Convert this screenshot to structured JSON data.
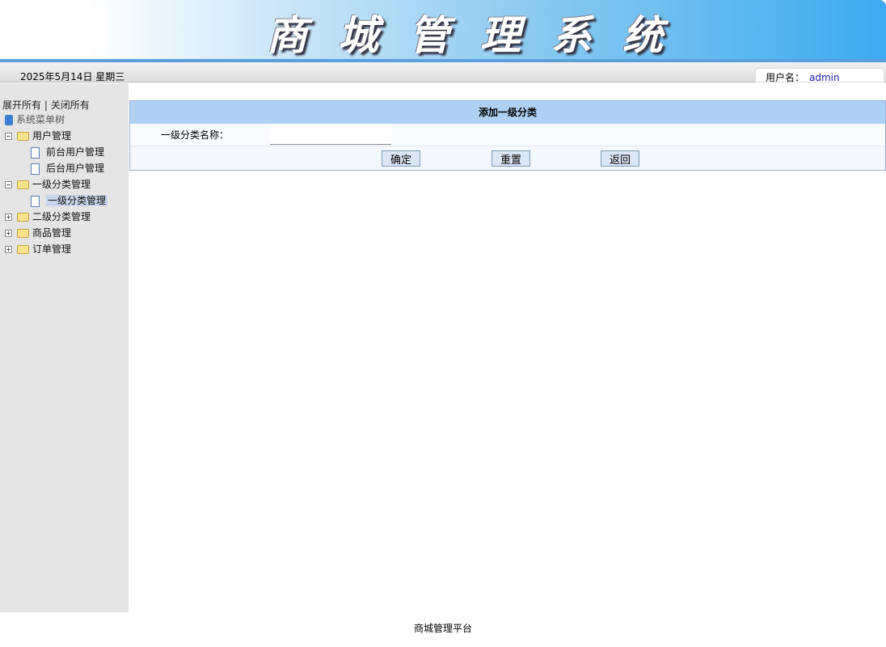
{
  "header": {
    "title": "商城管理系统",
    "date": "2025年5月14日 星期三",
    "user_label": "用户名：",
    "user_name": "admin"
  },
  "sidebar": {
    "expand_all": "展开所有",
    "sep": "|",
    "collapse_all": "关闭所有",
    "root": "系统菜单树",
    "items": [
      {
        "label": "用户管理",
        "children": [
          "前台用户管理",
          "后台用户管理"
        ]
      },
      {
        "label": "一级分类管理",
        "children": [
          "一级分类管理"
        ]
      },
      {
        "label": "二级分类管理"
      },
      {
        "label": "商品管理"
      },
      {
        "label": "订单管理"
      }
    ]
  },
  "form": {
    "title": "添加一级分类",
    "field_label": "一级分类名称：",
    "field_value": "",
    "submit": "确定",
    "reset": "重置",
    "back": "返回"
  },
  "footer": "商城管理平台"
}
